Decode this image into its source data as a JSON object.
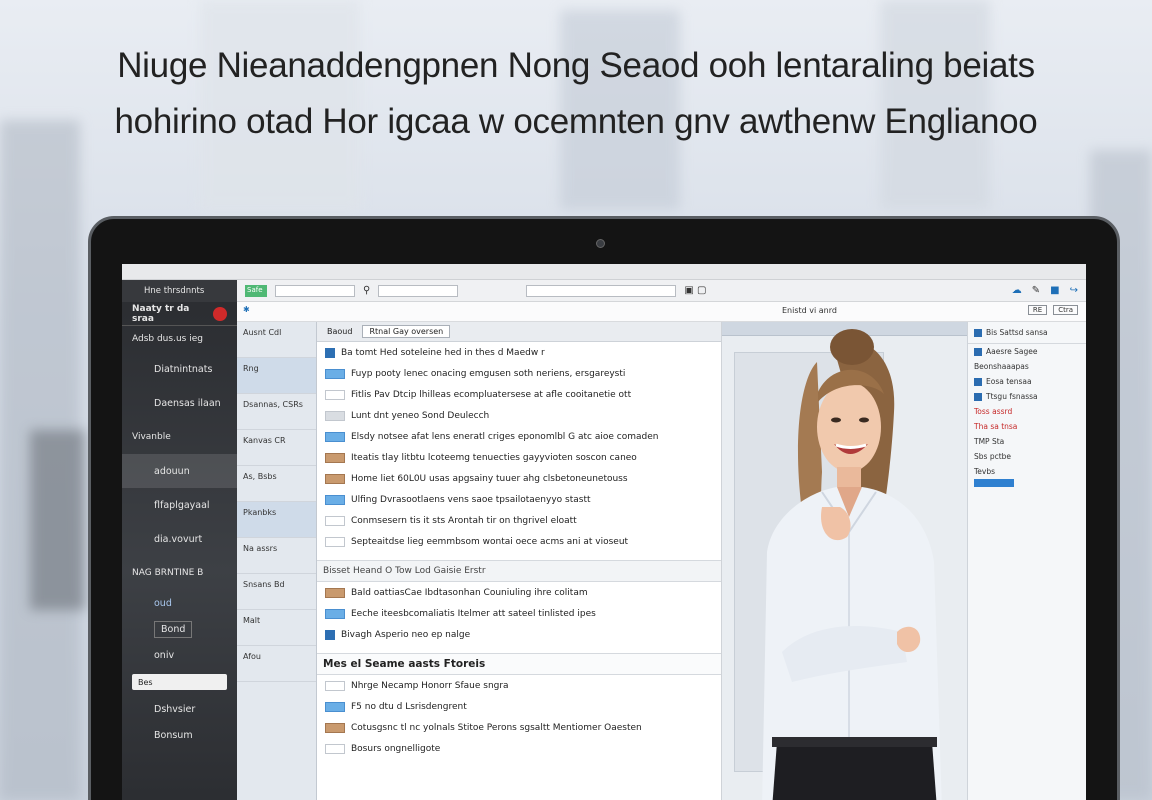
{
  "headline": {
    "line1": "Niuge Nieanaddengpnen Nong Seaod ooh lentaraling beiats",
    "line2": "hohirino otad Hor igcaa w ocemnten gnv awthenw Englianoo"
  },
  "toolbar": {
    "green_tag": "Safe",
    "right_label": "Search"
  },
  "subbar": {
    "title": "Enistd vi anrd",
    "buttons": [
      "RE",
      "Ctra"
    ]
  },
  "sidebar": {
    "header": "Hne  thrsdnnts",
    "brand": "Naaty tr da sraa",
    "sub": "Adsb dus.us ieg",
    "items": [
      "Diatnintnats",
      "Daensas ilaan",
      "Vivanble",
      "adouun",
      "flfaplgayaal",
      "dia.vovurt",
      "NAG BRNTINE B"
    ],
    "pills": [
      "oud",
      "Bond",
      "oniv",
      "Bes",
      "Dshvsier",
      "Bonsum"
    ]
  },
  "folders": [
    "Ausnt Cdl",
    "Rng",
    "Dsannas, CSRs",
    "Kanvas CR",
    "As, Bsbs",
    "Pkanbks",
    "Na assrs",
    "Snsans Bd",
    "Malt",
    "Afou"
  ],
  "list": {
    "tab1": "Baoud",
    "tab2": "Rtnal Gay oversen",
    "messages": [
      {
        "chip": "blue",
        "text": "Ba tomt Hed soteleine hed in thes d Maedw r"
      },
      {
        "chip": "lblue",
        "text": "Fuyp pooty lenec onacing emgusen soth neriens, ersgareysti"
      },
      {
        "chip": "none",
        "text": "Fitlis Pav Dtcip lhilleas ecompluatersese at afle cooitanetie ott"
      },
      {
        "chip": "grey",
        "text": "Lunt dnt yeneo Sond Deulecch"
      },
      {
        "chip": "lblue",
        "text": "Elsdy notsee afat lens eneratl criges eponomlbl G atc aioe comaden"
      },
      {
        "chip": "tan",
        "text": "Iteatis tlay litbtu lcoteemg tenuecties gayyvioten soscon caneo"
      },
      {
        "chip": "tan",
        "text": "Home liet 60L0U usas apgsainy  tuuer ahg clsbetoneunetouss"
      },
      {
        "chip": "lblue",
        "text": "Ulfing Dvrasootlaens vens saoe tpsailotaenyyo stastt"
      },
      {
        "chip": "none",
        "text": "Conmsesern tis it sts Arontah tir on thgrivel eloatt"
      },
      {
        "chip": "none",
        "text": "Septeaitdse lieg eemmbsom wontai oece acms ani at vioseut"
      }
    ],
    "section1": "Bisset  Heand O Tow Lod Gaisie Erstr",
    "messages2": [
      {
        "chip": "tan",
        "text": "Bald oattiasCae Ibdtasonhan Couniuling ihre colitam"
      },
      {
        "chip": "lblue",
        "text": "Eeche iteesbcomaliatis Itelmer att sateel tinlisted ipes"
      },
      {
        "chip": "blue",
        "text": "Bivagh Asperio neo ep nalge"
      }
    ],
    "section2": "Mes el Seame aasts Ftoreis",
    "messages3": [
      {
        "chip": "none",
        "text": "Nhrge Necamp Honorr Sfaue sngra"
      },
      {
        "chip": "lblue",
        "text": "F5 no dtu d Lsrisdengrent"
      },
      {
        "chip": "tan",
        "text": "Cotusgsnc tl nc yolnals Stitoe Perons sgsaltt Mentiomer Oaesten"
      },
      {
        "chip": "none",
        "text": "Bosurs ongnelligote"
      }
    ]
  },
  "rpanel": {
    "rows": [
      "Bis Sattsd sansa",
      "Aaesre Sagee",
      "Beonshaaapas",
      "Eosa tensaa",
      "Ttsgu fsnassa",
      "Toss assrd",
      "Tha sa tnsa",
      "TMP Sta",
      "Sbs pctbe",
      "Tevbs"
    ]
  }
}
